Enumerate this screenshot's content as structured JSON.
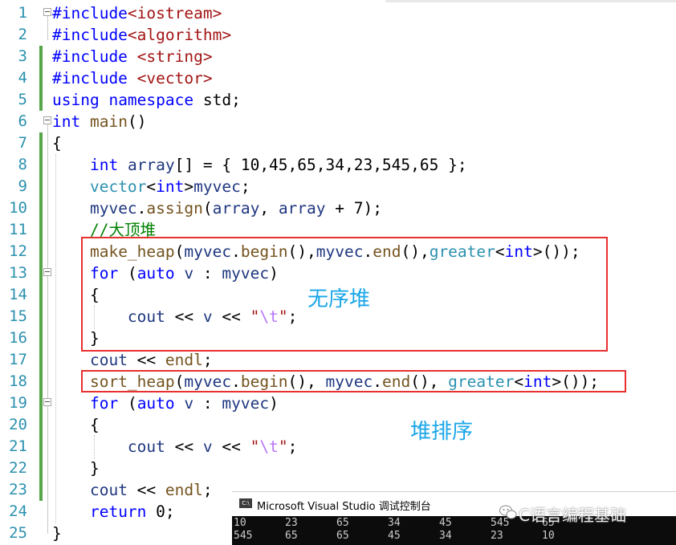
{
  "editor": {
    "line_numbers": [
      "1",
      "2",
      "3",
      "4",
      "5",
      "6",
      "7",
      "8",
      "9",
      "10",
      "11",
      "12",
      "13",
      "14",
      "15",
      "16",
      "17",
      "18",
      "19",
      "20",
      "21",
      "22",
      "23",
      "24",
      "25"
    ],
    "lines": [
      [
        [
          "k",
          "#include"
        ],
        [
          "s",
          "<iostream>"
        ]
      ],
      [
        [
          "k",
          "#include"
        ],
        [
          "s",
          "<algorithm>"
        ]
      ],
      [
        [
          "k",
          "#include "
        ],
        [
          "s",
          "<string>"
        ]
      ],
      [
        [
          "k",
          "#include "
        ],
        [
          "s",
          "<vector>"
        ]
      ],
      [
        [
          "k",
          "using"
        ],
        [
          "n",
          " "
        ],
        [
          "k",
          "namespace"
        ],
        [
          "n",
          " std;"
        ]
      ],
      [
        [
          "k",
          "int"
        ],
        [
          "n",
          " "
        ],
        [
          "f",
          "main"
        ],
        [
          "n",
          "()"
        ]
      ],
      [
        [
          "n",
          "{"
        ]
      ],
      [
        [
          "n",
          "    "
        ],
        [
          "k",
          "int"
        ],
        [
          "n",
          " "
        ],
        [
          "v",
          "array"
        ],
        [
          "n",
          "[] = { 10,45,65,34,23,545,65 };"
        ]
      ],
      [
        [
          "n",
          "    "
        ],
        [
          "t",
          "vector"
        ],
        [
          "n",
          "<"
        ],
        [
          "k",
          "int"
        ],
        [
          "n",
          ">"
        ],
        [
          "v",
          "myvec"
        ],
        [
          "n",
          ";"
        ]
      ],
      [
        [
          "n",
          "    "
        ],
        [
          "v",
          "myvec"
        ],
        [
          "n",
          "."
        ],
        [
          "f",
          "assign"
        ],
        [
          "n",
          "("
        ],
        [
          "v",
          "array"
        ],
        [
          "n",
          ", "
        ],
        [
          "v",
          "array"
        ],
        [
          "n",
          " + 7);"
        ]
      ],
      [
        [
          "n",
          "    "
        ],
        [
          "c",
          "//大顶堆"
        ]
      ],
      [
        [
          "n",
          "    "
        ],
        [
          "f",
          "make_heap"
        ],
        [
          "n",
          "("
        ],
        [
          "v",
          "myvec"
        ],
        [
          "n",
          "."
        ],
        [
          "f",
          "begin"
        ],
        [
          "n",
          "(),"
        ],
        [
          "v",
          "myvec"
        ],
        [
          "n",
          "."
        ],
        [
          "f",
          "end"
        ],
        [
          "n",
          "(),"
        ],
        [
          "t",
          "greater"
        ],
        [
          "n",
          "<"
        ],
        [
          "k",
          "int"
        ],
        [
          "n",
          ">());"
        ]
      ],
      [
        [
          "n",
          "    "
        ],
        [
          "k",
          "for"
        ],
        [
          "n",
          " ("
        ],
        [
          "k",
          "auto"
        ],
        [
          "n",
          " "
        ],
        [
          "v",
          "v"
        ],
        [
          "n",
          " : "
        ],
        [
          "v",
          "myvec"
        ],
        [
          "n",
          ")"
        ]
      ],
      [
        [
          "n",
          "    {"
        ]
      ],
      [
        [
          "n",
          "        "
        ],
        [
          "v",
          "cout"
        ],
        [
          "n",
          " << "
        ],
        [
          "v",
          "v"
        ],
        [
          "n",
          " << "
        ],
        [
          "s",
          "\""
        ],
        [
          "esc",
          "\\t"
        ],
        [
          "s",
          "\""
        ],
        [
          "n",
          ";"
        ]
      ],
      [
        [
          "n",
          "    }"
        ]
      ],
      [
        [
          "n",
          "    "
        ],
        [
          "v",
          "cout"
        ],
        [
          "n",
          " << "
        ],
        [
          "f",
          "endl"
        ],
        [
          "n",
          ";"
        ]
      ],
      [
        [
          "n",
          "    "
        ],
        [
          "f",
          "sort_heap"
        ],
        [
          "n",
          "("
        ],
        [
          "v",
          "myvec"
        ],
        [
          "n",
          "."
        ],
        [
          "f",
          "begin"
        ],
        [
          "n",
          "(), "
        ],
        [
          "v",
          "myvec"
        ],
        [
          "n",
          "."
        ],
        [
          "f",
          "end"
        ],
        [
          "n",
          "(), "
        ],
        [
          "t",
          "greater"
        ],
        [
          "n",
          "<"
        ],
        [
          "k",
          "int"
        ],
        [
          "n",
          ">());"
        ]
      ],
      [
        [
          "n",
          "    "
        ],
        [
          "k",
          "for"
        ],
        [
          "n",
          " ("
        ],
        [
          "k",
          "auto"
        ],
        [
          "n",
          " "
        ],
        [
          "v",
          "v"
        ],
        [
          "n",
          " : "
        ],
        [
          "v",
          "myvec"
        ],
        [
          "n",
          ")"
        ]
      ],
      [
        [
          "n",
          "    {"
        ]
      ],
      [
        [
          "n",
          "        "
        ],
        [
          "v",
          "cout"
        ],
        [
          "n",
          " << "
        ],
        [
          "v",
          "v"
        ],
        [
          "n",
          " << "
        ],
        [
          "s",
          "\""
        ],
        [
          "esc",
          "\\t"
        ],
        [
          "s",
          "\""
        ],
        [
          "n",
          ";"
        ]
      ],
      [
        [
          "n",
          "    }"
        ]
      ],
      [
        [
          "n",
          "    "
        ],
        [
          "v",
          "cout"
        ],
        [
          "n",
          " << "
        ],
        [
          "f",
          "endl"
        ],
        [
          "n",
          ";"
        ]
      ],
      [
        [
          "n",
          "    "
        ],
        [
          "k",
          "return"
        ],
        [
          "n",
          " 0;"
        ]
      ],
      [
        [
          "n",
          "}"
        ]
      ]
    ]
  },
  "annotations": {
    "unordered_heap": "无序堆",
    "heap_sort": "堆排序"
  },
  "console": {
    "title": "Microsoft Visual Studio 调试控制台",
    "icon_label": "C:\\",
    "rows": [
      [
        "10",
        "23",
        "65",
        "34",
        "45",
        "545",
        "65"
      ],
      [
        "545",
        "65",
        "65",
        "45",
        "34",
        "23",
        "10"
      ]
    ]
  },
  "watermark": {
    "text": "C语言编程基础"
  },
  "colors": {
    "keyword": "#0000ff",
    "type": "#2b91af",
    "string": "#a31515",
    "comment": "#008000",
    "function": "#74531f",
    "variable": "#1f377f",
    "line_number": "#2b91af",
    "change_marker": "#57a64a",
    "highlight_box": "#e83030",
    "annotation": "#1aa6e8",
    "console_bg": "#0c0c0c"
  }
}
